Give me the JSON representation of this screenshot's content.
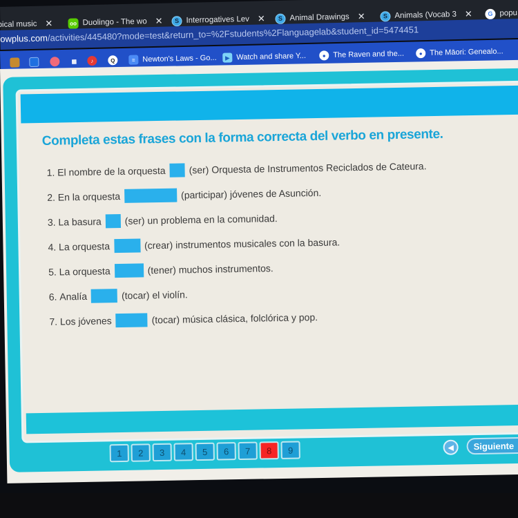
{
  "browser": {
    "tabs": [
      {
        "label": "pical music",
        "favicon": "music-icon"
      },
      {
        "label": "Duolingo - The wo",
        "favicon": "duolingo-icon"
      },
      {
        "label": "Interrogatives Lev",
        "favicon": "s-icon"
      },
      {
        "label": "Animal Drawings",
        "favicon": "s-icon"
      },
      {
        "label": "Animals (Vocab 3",
        "favicon": "s-icon"
      },
      {
        "label": "popu",
        "favicon": "google-icon"
      }
    ],
    "close_glyph": "✕",
    "url_host": "owplus.com",
    "url_path": "/activities/445480?mode=test&return_to=%2Fstudents%2Flanguagelab&student_id=5474451",
    "bookmarks": [
      {
        "label": "Newton's Laws - Go...",
        "icon": "docs-icon"
      },
      {
        "label": "Watch and share Y...",
        "icon": "play-icon"
      },
      {
        "label": "The Raven and the...",
        "icon": "globe-icon"
      },
      {
        "label": "The Māori: Genealo...",
        "icon": "globe-icon"
      }
    ]
  },
  "activity": {
    "instructions": "Completa estas frases con la forma correcta del verbo en presente.",
    "questions": [
      {
        "number": "1.",
        "before": "El nombre de la orquesta",
        "after": "(ser) Orquesta de Instrumentos Reciclados de Cateura.",
        "answer": ""
      },
      {
        "number": "2.",
        "before": "En la orquesta",
        "after": "(participar) jóvenes de Asunción.",
        "answer": ""
      },
      {
        "number": "3.",
        "before": "La basura",
        "after": "(ser) un problema en la comunidad.",
        "answer": ""
      },
      {
        "number": "4.",
        "before": "La orquesta",
        "after": "(crear) instrumentos musicales con la basura.",
        "answer": ""
      },
      {
        "number": "5.",
        "before": "La orquesta",
        "after": "(tener) muchos instrumentos.",
        "answer": ""
      },
      {
        "number": "6.",
        "before": "Analía",
        "after": "(tocar) el violín.",
        "answer": ""
      },
      {
        "number": "7.",
        "before": "Los jóvenes",
        "after": "(tocar) música clásica, folclórica y pop.",
        "answer": ""
      }
    ],
    "pages": [
      "1",
      "2",
      "3",
      "4",
      "5",
      "6",
      "7",
      "8",
      "9"
    ],
    "current_page": "8",
    "prev_glyph": "◀",
    "next_label": "Siguiente",
    "next_glyph": "▶"
  },
  "colors": {
    "accent": "#1aa5d8",
    "frame": "#1fc1d6",
    "blank": "#2ab0ec",
    "active_page": "#f52525"
  }
}
